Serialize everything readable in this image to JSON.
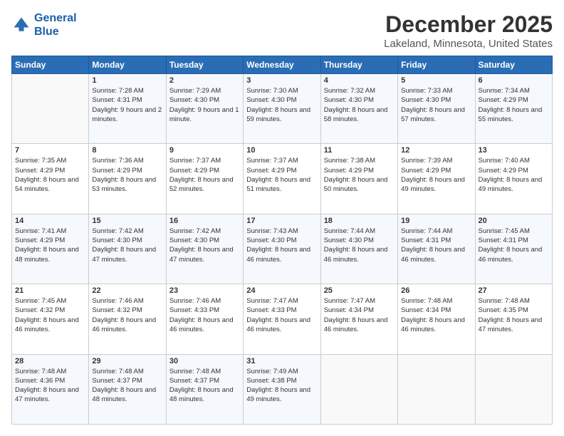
{
  "header": {
    "logo_line1": "General",
    "logo_line2": "Blue",
    "title": "December 2025",
    "subtitle": "Lakeland, Minnesota, United States"
  },
  "days_of_week": [
    "Sunday",
    "Monday",
    "Tuesday",
    "Wednesday",
    "Thursday",
    "Friday",
    "Saturday"
  ],
  "weeks": [
    [
      {
        "day": null,
        "sunrise": null,
        "sunset": null,
        "daylight": null
      },
      {
        "day": "1",
        "sunrise": "Sunrise: 7:28 AM",
        "sunset": "Sunset: 4:31 PM",
        "daylight": "Daylight: 9 hours and 2 minutes."
      },
      {
        "day": "2",
        "sunrise": "Sunrise: 7:29 AM",
        "sunset": "Sunset: 4:30 PM",
        "daylight": "Daylight: 9 hours and 1 minute."
      },
      {
        "day": "3",
        "sunrise": "Sunrise: 7:30 AM",
        "sunset": "Sunset: 4:30 PM",
        "daylight": "Daylight: 8 hours and 59 minutes."
      },
      {
        "day": "4",
        "sunrise": "Sunrise: 7:32 AM",
        "sunset": "Sunset: 4:30 PM",
        "daylight": "Daylight: 8 hours and 58 minutes."
      },
      {
        "day": "5",
        "sunrise": "Sunrise: 7:33 AM",
        "sunset": "Sunset: 4:30 PM",
        "daylight": "Daylight: 8 hours and 57 minutes."
      },
      {
        "day": "6",
        "sunrise": "Sunrise: 7:34 AM",
        "sunset": "Sunset: 4:29 PM",
        "daylight": "Daylight: 8 hours and 55 minutes."
      }
    ],
    [
      {
        "day": "7",
        "sunrise": "Sunrise: 7:35 AM",
        "sunset": "Sunset: 4:29 PM",
        "daylight": "Daylight: 8 hours and 54 minutes."
      },
      {
        "day": "8",
        "sunrise": "Sunrise: 7:36 AM",
        "sunset": "Sunset: 4:29 PM",
        "daylight": "Daylight: 8 hours and 53 minutes."
      },
      {
        "day": "9",
        "sunrise": "Sunrise: 7:37 AM",
        "sunset": "Sunset: 4:29 PM",
        "daylight": "Daylight: 8 hours and 52 minutes."
      },
      {
        "day": "10",
        "sunrise": "Sunrise: 7:37 AM",
        "sunset": "Sunset: 4:29 PM",
        "daylight": "Daylight: 8 hours and 51 minutes."
      },
      {
        "day": "11",
        "sunrise": "Sunrise: 7:38 AM",
        "sunset": "Sunset: 4:29 PM",
        "daylight": "Daylight: 8 hours and 50 minutes."
      },
      {
        "day": "12",
        "sunrise": "Sunrise: 7:39 AM",
        "sunset": "Sunset: 4:29 PM",
        "daylight": "Daylight: 8 hours and 49 minutes."
      },
      {
        "day": "13",
        "sunrise": "Sunrise: 7:40 AM",
        "sunset": "Sunset: 4:29 PM",
        "daylight": "Daylight: 8 hours and 49 minutes."
      }
    ],
    [
      {
        "day": "14",
        "sunrise": "Sunrise: 7:41 AM",
        "sunset": "Sunset: 4:29 PM",
        "daylight": "Daylight: 8 hours and 48 minutes."
      },
      {
        "day": "15",
        "sunrise": "Sunrise: 7:42 AM",
        "sunset": "Sunset: 4:30 PM",
        "daylight": "Daylight: 8 hours and 47 minutes."
      },
      {
        "day": "16",
        "sunrise": "Sunrise: 7:42 AM",
        "sunset": "Sunset: 4:30 PM",
        "daylight": "Daylight: 8 hours and 47 minutes."
      },
      {
        "day": "17",
        "sunrise": "Sunrise: 7:43 AM",
        "sunset": "Sunset: 4:30 PM",
        "daylight": "Daylight: 8 hours and 46 minutes."
      },
      {
        "day": "18",
        "sunrise": "Sunrise: 7:44 AM",
        "sunset": "Sunset: 4:30 PM",
        "daylight": "Daylight: 8 hours and 46 minutes."
      },
      {
        "day": "19",
        "sunrise": "Sunrise: 7:44 AM",
        "sunset": "Sunset: 4:31 PM",
        "daylight": "Daylight: 8 hours and 46 minutes."
      },
      {
        "day": "20",
        "sunrise": "Sunrise: 7:45 AM",
        "sunset": "Sunset: 4:31 PM",
        "daylight": "Daylight: 8 hours and 46 minutes."
      }
    ],
    [
      {
        "day": "21",
        "sunrise": "Sunrise: 7:45 AM",
        "sunset": "Sunset: 4:32 PM",
        "daylight": "Daylight: 8 hours and 46 minutes."
      },
      {
        "day": "22",
        "sunrise": "Sunrise: 7:46 AM",
        "sunset": "Sunset: 4:32 PM",
        "daylight": "Daylight: 8 hours and 46 minutes."
      },
      {
        "day": "23",
        "sunrise": "Sunrise: 7:46 AM",
        "sunset": "Sunset: 4:33 PM",
        "daylight": "Daylight: 8 hours and 46 minutes."
      },
      {
        "day": "24",
        "sunrise": "Sunrise: 7:47 AM",
        "sunset": "Sunset: 4:33 PM",
        "daylight": "Daylight: 8 hours and 46 minutes."
      },
      {
        "day": "25",
        "sunrise": "Sunrise: 7:47 AM",
        "sunset": "Sunset: 4:34 PM",
        "daylight": "Daylight: 8 hours and 46 minutes."
      },
      {
        "day": "26",
        "sunrise": "Sunrise: 7:48 AM",
        "sunset": "Sunset: 4:34 PM",
        "daylight": "Daylight: 8 hours and 46 minutes."
      },
      {
        "day": "27",
        "sunrise": "Sunrise: 7:48 AM",
        "sunset": "Sunset: 4:35 PM",
        "daylight": "Daylight: 8 hours and 47 minutes."
      }
    ],
    [
      {
        "day": "28",
        "sunrise": "Sunrise: 7:48 AM",
        "sunset": "Sunset: 4:36 PM",
        "daylight": "Daylight: 8 hours and 47 minutes."
      },
      {
        "day": "29",
        "sunrise": "Sunrise: 7:48 AM",
        "sunset": "Sunset: 4:37 PM",
        "daylight": "Daylight: 8 hours and 48 minutes."
      },
      {
        "day": "30",
        "sunrise": "Sunrise: 7:48 AM",
        "sunset": "Sunset: 4:37 PM",
        "daylight": "Daylight: 8 hours and 48 minutes."
      },
      {
        "day": "31",
        "sunrise": "Sunrise: 7:49 AM",
        "sunset": "Sunset: 4:38 PM",
        "daylight": "Daylight: 8 hours and 49 minutes."
      },
      {
        "day": null,
        "sunrise": null,
        "sunset": null,
        "daylight": null
      },
      {
        "day": null,
        "sunrise": null,
        "sunset": null,
        "daylight": null
      },
      {
        "day": null,
        "sunrise": null,
        "sunset": null,
        "daylight": null
      }
    ]
  ]
}
